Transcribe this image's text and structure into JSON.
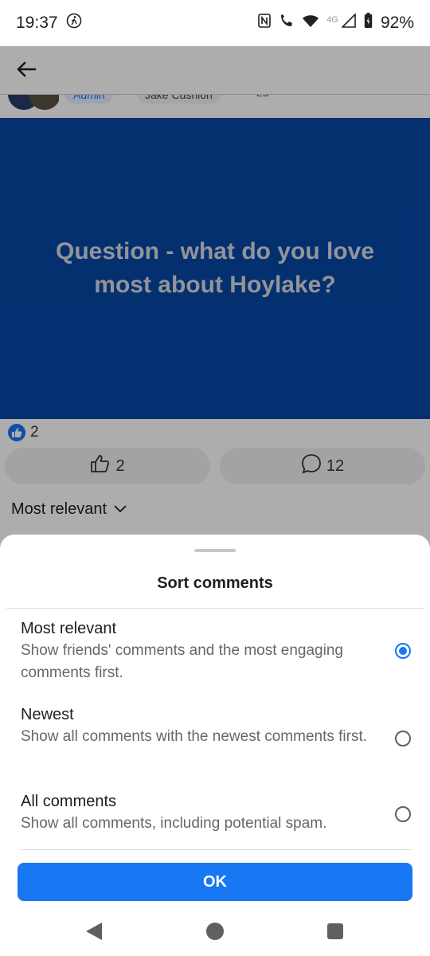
{
  "status": {
    "time": "19:37",
    "network": "4G",
    "battery": "92%"
  },
  "post": {
    "admin_chip": "Admin",
    "author": "Jake Cushion",
    "time": "2d",
    "question": "Question - what do you love most about Hoylake?",
    "reaction_count": "2",
    "like_count": "2",
    "comment_count": "12",
    "sort_label": "Most relevant"
  },
  "sheet": {
    "title": "Sort comments",
    "options": [
      {
        "title": "Most relevant",
        "desc": "Show friends' comments and the most engaging comments first.",
        "selected": true
      },
      {
        "title": "Newest",
        "desc": "Show all comments with the newest comments first.",
        "selected": false
      },
      {
        "title": "All comments",
        "desc": "Show all comments, including potential spam.",
        "selected": false
      }
    ],
    "ok_label": "OK"
  },
  "colors": {
    "accent": "#1877f2",
    "post_bg": "#0747A6"
  }
}
